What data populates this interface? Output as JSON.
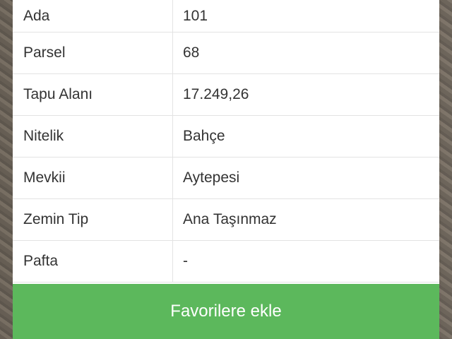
{
  "details": {
    "rows": [
      {
        "label": "Ada",
        "value": "101"
      },
      {
        "label": "Parsel",
        "value": "68"
      },
      {
        "label": "Tapu Alanı",
        "value": "17.249,26"
      },
      {
        "label": "Nitelik",
        "value": "Bahçe"
      },
      {
        "label": "Mevkii",
        "value": "Aytepesi"
      },
      {
        "label": "Zemin Tip",
        "value": "Ana Taşınmaz"
      },
      {
        "label": "Pafta",
        "value": "-"
      }
    ]
  },
  "actions": {
    "favorite_label": "Favorilere ekle"
  },
  "colors": {
    "button_green": "#5cb85c",
    "text": "#333333",
    "divider": "#e3e3e3"
  }
}
